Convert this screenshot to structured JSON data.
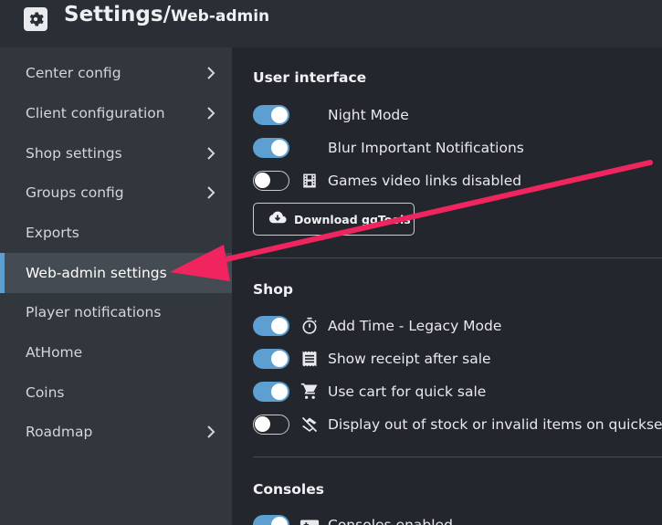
{
  "header": {
    "title": "Settings/",
    "subtitle": "Web-admin",
    "icon": "gear-icon"
  },
  "sidebar": {
    "items": [
      {
        "label": "Center config",
        "chevron": true
      },
      {
        "label": "Client configuration",
        "chevron": true
      },
      {
        "label": "Shop settings",
        "chevron": true
      },
      {
        "label": "Groups config",
        "chevron": true
      },
      {
        "label": "Exports",
        "chevron": false
      },
      {
        "label": "Web-admin settings",
        "chevron": false,
        "active": true
      },
      {
        "label": "Player notifications",
        "chevron": false
      },
      {
        "label": "AtHome",
        "chevron": false
      },
      {
        "label": "Coins",
        "chevron": false
      },
      {
        "label": "Roadmap",
        "chevron": true
      }
    ]
  },
  "sections": {
    "ui": {
      "title": "User interface",
      "rows": [
        {
          "label": "Night Mode",
          "on": true,
          "icon": "moon-icon"
        },
        {
          "label": "Blur Important Notifications",
          "on": true,
          "icon": "moon-icon"
        },
        {
          "label": "Games video links disabled",
          "on": false,
          "icon": "film-icon"
        }
      ],
      "download_label": "Download ggTools",
      "download_icon": "cloud-download-icon"
    },
    "shop": {
      "title": "Shop",
      "rows": [
        {
          "label": "Add Time - Legacy Mode",
          "on": true,
          "icon": "stopwatch-icon"
        },
        {
          "label": "Show receipt after sale",
          "on": true,
          "icon": "receipt-icon"
        },
        {
          "label": "Use cart for quick sale",
          "on": true,
          "icon": "cart-icon"
        },
        {
          "label": "Display out of stock or invalid items on quicksell",
          "on": false,
          "icon": "layers-off-icon"
        }
      ]
    },
    "consoles": {
      "title": "Consoles",
      "rows": [
        {
          "label": "Consoles enabled",
          "on": true,
          "icon": "gamepad-icon"
        }
      ]
    }
  },
  "colors": {
    "accent": "#5c9fd0",
    "annotation_arrow": "#f0255f",
    "sidebar_bg": "#32373e",
    "main_bg": "#23272d"
  }
}
